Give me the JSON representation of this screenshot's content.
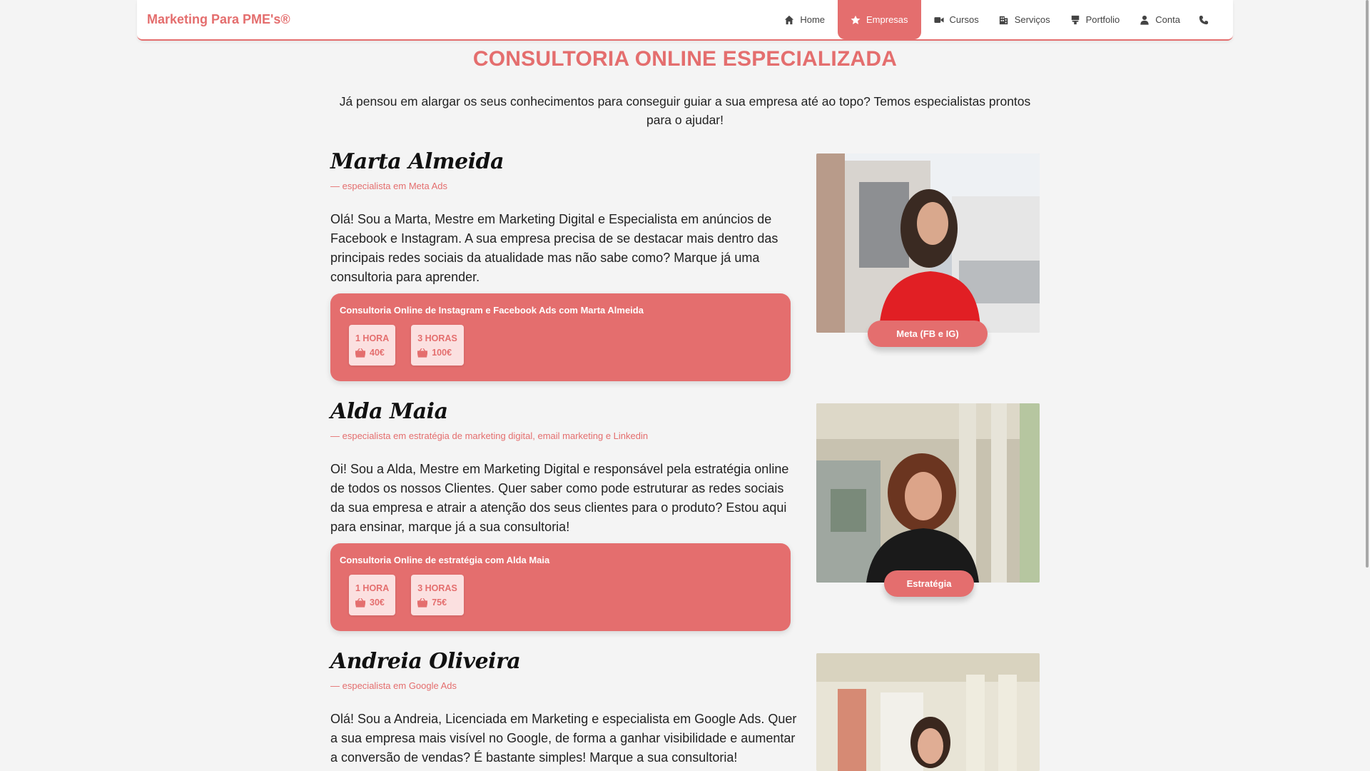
{
  "brand": "Marketing Para PME's®",
  "nav": {
    "items": [
      {
        "label": "Home",
        "icon": "home-icon",
        "active": false
      },
      {
        "label": "Empresas",
        "icon": "star-icon",
        "active": true
      },
      {
        "label": "Cursos",
        "icon": "video-camera-icon",
        "active": false
      },
      {
        "label": "Serviços",
        "icon": "building-icon",
        "active": false
      },
      {
        "label": "Portfolio",
        "icon": "brush-icon",
        "active": false
      },
      {
        "label": "Conta",
        "icon": "user-icon",
        "active": false
      }
    ],
    "phone_icon": "phone-icon"
  },
  "header": {
    "title": "CONSULTORIA ONLINE ESPECIALIZADA",
    "intro": "Já pensou em alargar os seus conhecimentos para conseguir guiar a sua empresa até ao topo? Temos especialistas prontos para o ajudar!"
  },
  "consultants": [
    {
      "name": "Marta Almeida",
      "specialty": "— especialista em Meta Ads",
      "bio": "Olá! Sou a Marta, Mestre em Marketing Digital e Especialista em anúncios de Facebook e Instagram. A sua empresa precisa de se destacar mais dentro das principais redes sociais da atualidade mas não sabe como? Marque já uma consultoria para aprender.",
      "box_title": "Consultoria Online de Instagram e Facebook Ads com Marta Almeida",
      "options": [
        {
          "duration": "1 HORA",
          "price": "40€"
        },
        {
          "duration": "3 HORAS",
          "price": "100€"
        }
      ],
      "tag": "Meta (FB e IG)"
    },
    {
      "name": "Alda Maia",
      "specialty": "— especialista em estratégia de marketing digital, email marketing e Linkedin",
      "bio": "Oi! Sou a Alda, Mestre em Marketing Digital e responsável pela estratégia online de todos os nossos Clientes. Quer saber como pode estruturar as redes sociais da sua empresa e atrair a atenção dos seus clientes para o produto? Estou aqui para ensinar, marque já a sua consultoria!",
      "box_title": "Consultoria Online de estratégia com Alda Maia",
      "options": [
        {
          "duration": "1 HORA",
          "price": "30€"
        },
        {
          "duration": "3 HORAS",
          "price": "75€"
        }
      ],
      "tag": "Estratégia"
    },
    {
      "name": "Andreia Oliveira",
      "specialty": "— especialista em Google Ads",
      "bio": "Olá! Sou a Andreia, Licenciada em Marketing e especialista em Google Ads. Quer a sua empresa mais visível no Google, de forma a ganhar visibilidade e aumentar a conversão de vendas? É bastante simples! Marque a sua consultoria!"
    }
  ],
  "colors": {
    "accent": "#e46e6e",
    "accent_light": "#fbe0e0",
    "background": "#f4f4f4"
  }
}
